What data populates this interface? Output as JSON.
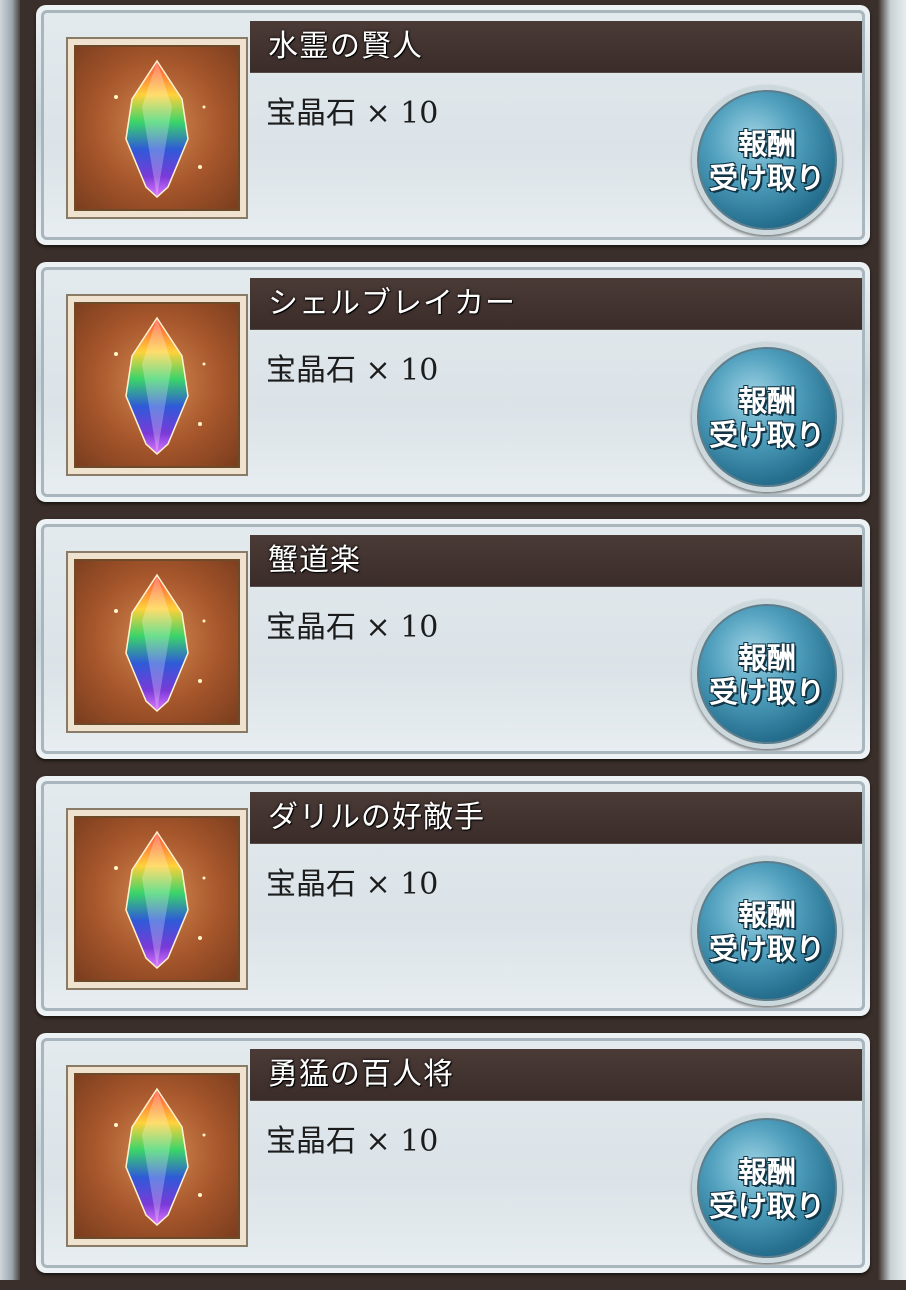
{
  "colors": {
    "title_bar": "#3f302c",
    "card_bg": "#dbe3e8",
    "button_blue": "#2f7fa0",
    "thumb_bg": "#a6562b"
  },
  "items": [
    {
      "title": "水霊の賢人",
      "reward": "宝晶石 × 10",
      "icon": "rainbow-crystal-icon",
      "button_line1": "報酬",
      "button_line2": "受け取り"
    },
    {
      "title": "シェルブレイカー",
      "reward": "宝晶石 × 10",
      "icon": "rainbow-crystal-icon",
      "button_line1": "報酬",
      "button_line2": "受け取り"
    },
    {
      "title": "蟹道楽",
      "reward": "宝晶石 × 10",
      "icon": "rainbow-crystal-icon",
      "button_line1": "報酬",
      "button_line2": "受け取り"
    },
    {
      "title": "ダリルの好敵手",
      "reward": "宝晶石 × 10",
      "icon": "rainbow-crystal-icon",
      "button_line1": "報酬",
      "button_line2": "受け取り"
    },
    {
      "title": "勇猛の百人将",
      "reward": "宝晶石 × 10",
      "icon": "rainbow-crystal-icon",
      "button_line1": "報酬",
      "button_line2": "受け取り"
    }
  ]
}
